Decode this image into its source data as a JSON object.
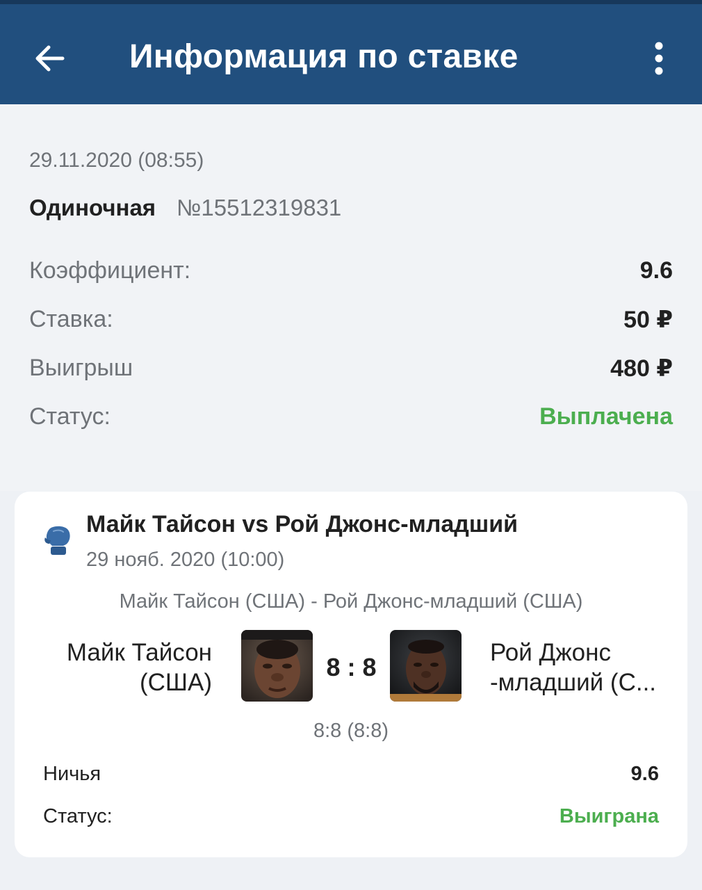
{
  "header": {
    "title": "Информация по ставке",
    "back_icon": "arrow-back-icon",
    "menu_icon": "more-vertical-icon",
    "colors": {
      "background": "#214f7e",
      "text": "#ffffff"
    }
  },
  "bet": {
    "datetime": "29.11.2020 (08:55)",
    "type": "Одиночная",
    "number": "№15512319831",
    "rows": [
      {
        "label": "Коэффициент:",
        "value": "9.6"
      },
      {
        "label": "Ставка:",
        "value": "50 ₽"
      },
      {
        "label": "Выигрыш",
        "value": "480 ₽"
      },
      {
        "label": "Статус:",
        "value": "Выплачена"
      }
    ],
    "status_color": "#4cae4f"
  },
  "event": {
    "sport_icon": "boxing-glove-icon",
    "title": "Майк Тайсон vs Рой Джонс-младший",
    "date": "29 нояб. 2020 (10:00)",
    "subtitle": "Майк Тайсон (США) - Рой Джонс-младший (США)",
    "team1": {
      "name_line1": "Майк Тайсон",
      "name_line2": "(США)"
    },
    "team2": {
      "name_line1": "Рой Джонс",
      "name_line2": "-младший (С..."
    },
    "score": "8 : 8",
    "score_detail": "8:8 (8:8)",
    "outcome": {
      "label": "Ничья",
      "value": "9.6"
    },
    "status": {
      "label": "Статус:",
      "value": "Выиграна"
    }
  }
}
